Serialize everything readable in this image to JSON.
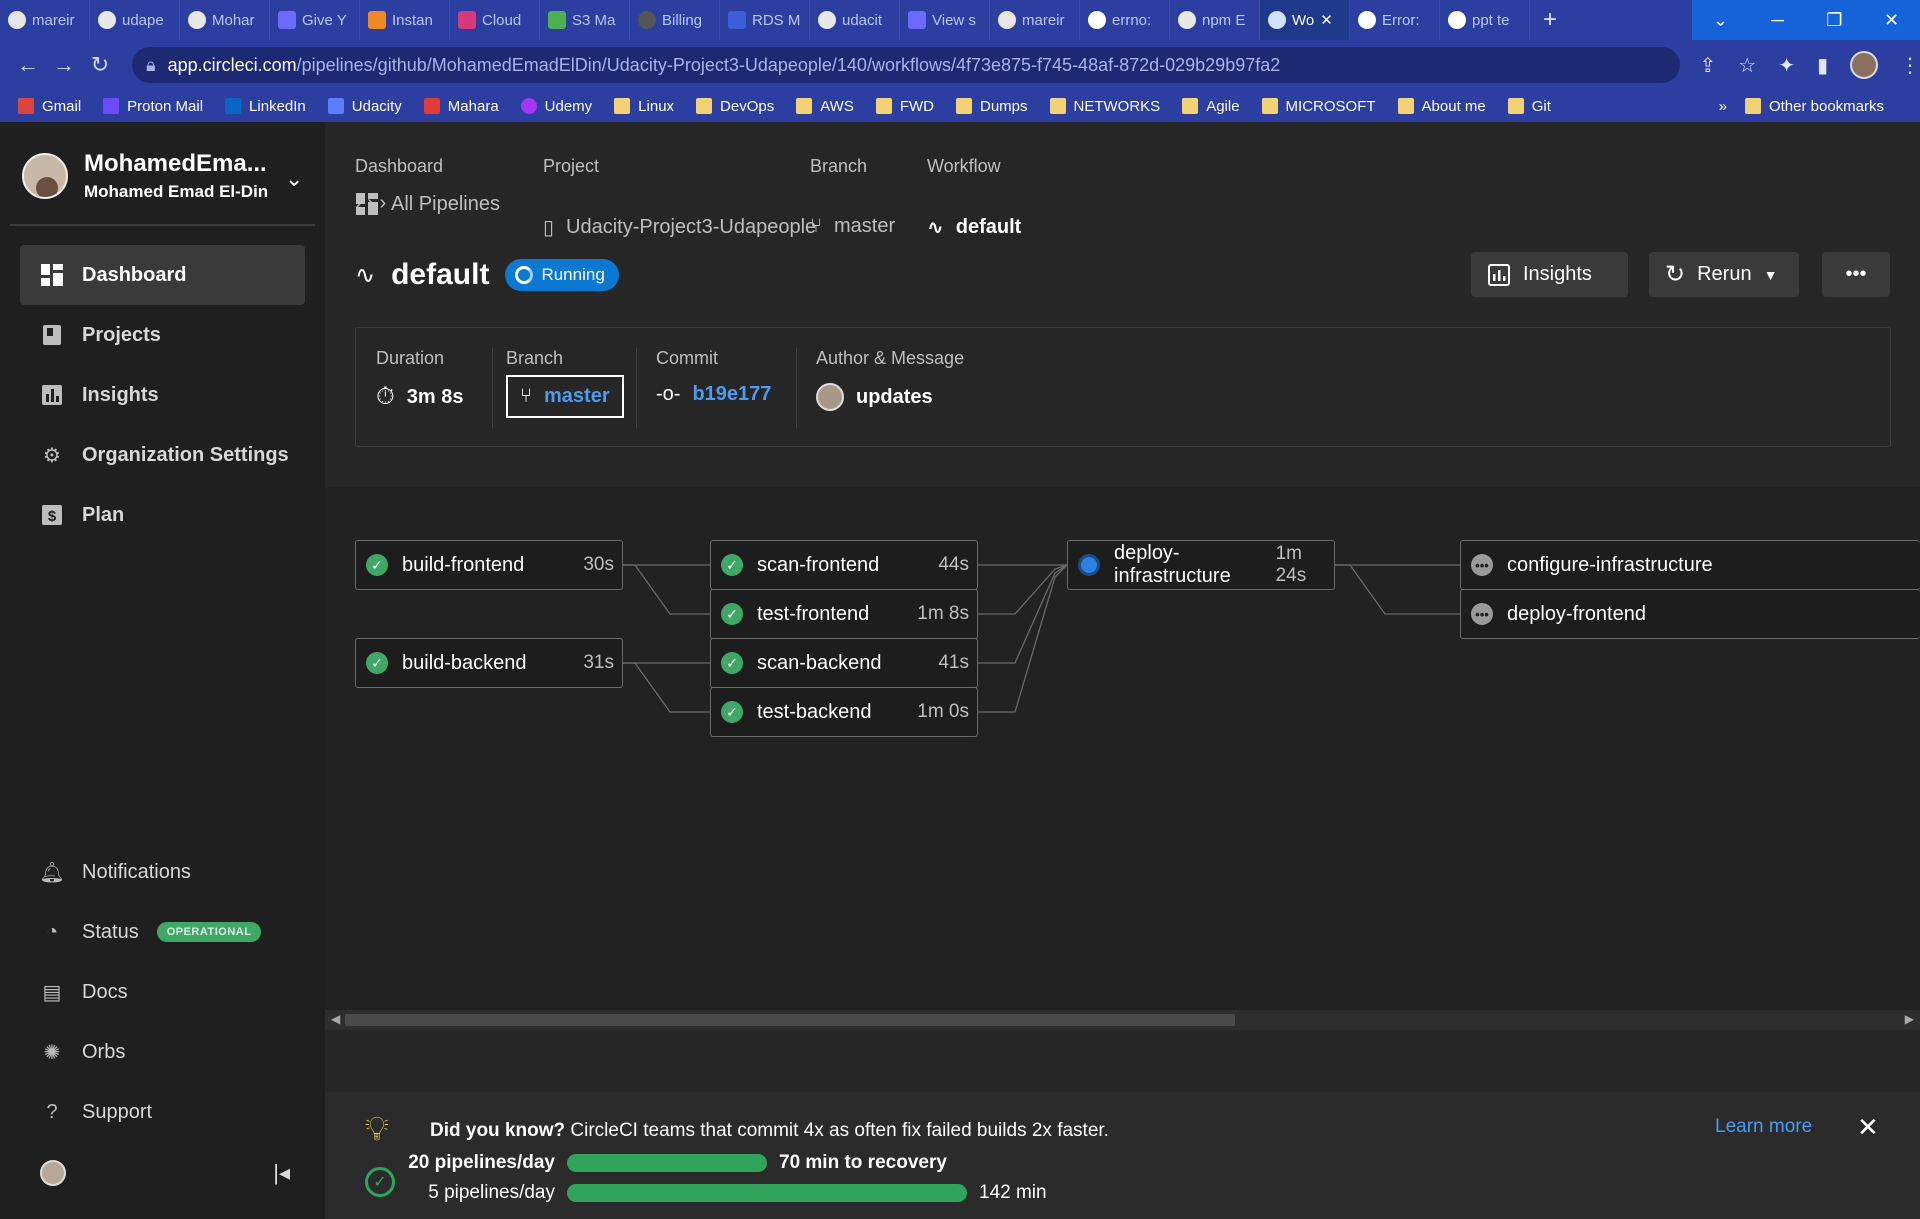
{
  "browser": {
    "tabs": [
      {
        "label": "mareir",
        "active": false
      },
      {
        "label": "udape",
        "active": false
      },
      {
        "label": "Mohar",
        "active": false
      },
      {
        "label": "Give Y",
        "active": false
      },
      {
        "label": "Instan",
        "active": false
      },
      {
        "label": "Cloud",
        "active": false
      },
      {
        "label": "S3 Ma",
        "active": false
      },
      {
        "label": "Billing",
        "active": false
      },
      {
        "label": "RDS M",
        "active": false
      },
      {
        "label": "udacit",
        "active": false
      },
      {
        "label": "View s",
        "active": false
      },
      {
        "label": "mareir",
        "active": false
      },
      {
        "label": "errno:",
        "active": false
      },
      {
        "label": "npm E",
        "active": false
      },
      {
        "label": "Wo",
        "active": true
      },
      {
        "label": "Error:",
        "active": false
      },
      {
        "label": "ppt te",
        "active": false
      }
    ],
    "url_host": "app.circleci.com",
    "url_path": "/pipelines/github/MohamedEmadElDin/Udacity-Project3-Udapeople/140/workflows/4f73e875-f745-48af-872d-029b29b97fa2",
    "bookmarks": [
      "Gmail",
      "Proton Mail",
      "LinkedIn",
      "Udacity",
      "Mahara",
      "Udemy",
      "Linux",
      "DevOps",
      "AWS",
      "FWD",
      "Dumps",
      "NETWORKS",
      "Agile",
      "MICROSOFT",
      "About me",
      "Git"
    ],
    "bookmarks_more": "»",
    "other_bookmarks": "Other bookmarks"
  },
  "sidebar": {
    "user_name": "MohamedEma...",
    "user_full": "Mohamed Emad El-Din",
    "nav": [
      {
        "label": "Dashboard",
        "icon": "dashboard-icon",
        "active": true
      },
      {
        "label": "Projects",
        "icon": "projects-icon",
        "active": false
      },
      {
        "label": "Insights",
        "icon": "insights-icon",
        "active": false
      },
      {
        "label": "Organization Settings",
        "icon": "gear-icon",
        "active": false
      },
      {
        "label": "Plan",
        "icon": "dollar-icon",
        "active": false
      }
    ],
    "bottom": [
      {
        "label": "Notifications",
        "icon": "bell-icon"
      },
      {
        "label": "Status",
        "icon": "status-icon",
        "badge": "OPERATIONAL"
      },
      {
        "label": "Docs",
        "icon": "docs-icon"
      },
      {
        "label": "Orbs",
        "icon": "orbs-icon"
      },
      {
        "label": "Support",
        "icon": "help-icon"
      }
    ]
  },
  "breadcrumbs": {
    "labels": [
      "Dashboard",
      "Project",
      "Branch",
      "Workflow"
    ],
    "items": [
      "All Pipelines",
      "Udacity-Project3-Udapeople",
      "master",
      "default"
    ]
  },
  "workflow": {
    "title": "default",
    "status": "Running",
    "insights_label": "Insights",
    "rerun_label": "Rerun",
    "more_label": "•••"
  },
  "summary": {
    "duration_label": "Duration",
    "duration": "3m 8s",
    "branch_label": "Branch",
    "branch": "master",
    "commit_label": "Commit",
    "commit": "b19e177",
    "author_label": "Author & Message",
    "message": "updates"
  },
  "jobs": [
    {
      "name": "build-frontend",
      "duration": "30s",
      "status": "success"
    },
    {
      "name": "build-backend",
      "duration": "31s",
      "status": "success"
    },
    {
      "name": "scan-frontend",
      "duration": "44s",
      "status": "success"
    },
    {
      "name": "test-frontend",
      "duration": "1m 8s",
      "status": "success"
    },
    {
      "name": "scan-backend",
      "duration": "41s",
      "status": "success"
    },
    {
      "name": "test-backend",
      "duration": "1m 0s",
      "status": "success"
    },
    {
      "name": "deploy-infrastructure",
      "duration": "1m 24s",
      "status": "running"
    },
    {
      "name": "configure-infrastructure",
      "duration": "",
      "status": "waiting"
    },
    {
      "name": "deploy-frontend",
      "duration": "",
      "status": "waiting"
    }
  ],
  "tip": {
    "lead": "Did you know?",
    "text": " CircleCI teams that commit 4x as often fix failed builds 2x faster.",
    "learn_more": "Learn more",
    "row1_left": "20 pipelines/day",
    "row1_right": "70 min to recovery",
    "row2_left": "5 pipelines/day",
    "row2_right": "142 min"
  },
  "colors": {
    "accent": "#0b78d1",
    "success": "#3fa867",
    "link": "#4b9cf0"
  }
}
